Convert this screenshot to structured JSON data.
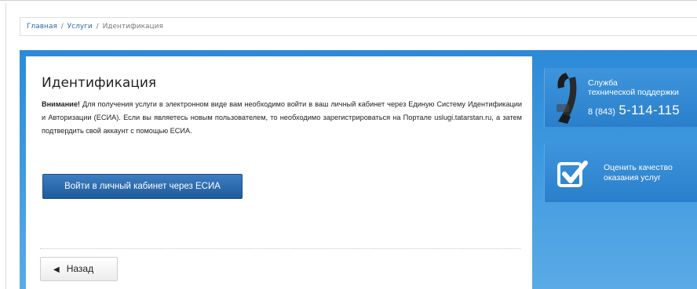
{
  "breadcrumb": {
    "home": "Главная",
    "services": "Услуги",
    "current": "Идентификация",
    "separator": "/"
  },
  "main": {
    "title": "Идентификация",
    "warning_label": "Внимание!",
    "warning_text": " Для получения услуги в электронном виде вам необходимо войти в ваш личный кабинет через Единую Систему Идентификации и Авторизации (ЕСИА). Если вы являетесь новым пользователем, то необходимо зарегистрироваться на Портале uslugi.tatarstan.ru, а затем подтвердить свой аккаунт с помощью ЕСИА.",
    "esia_button": "Войти в личный кабинет через ЕСИА",
    "back_button": "Назад"
  },
  "sidebar": {
    "support": {
      "title_line1": "Служба",
      "title_line2": "технической поддержки",
      "phone_prefix": "8 (843)",
      "phone_number": "5-114-115",
      "icon": "phone-icon"
    },
    "rate": {
      "title_line1": "Оценить качество",
      "title_line2": "оказания услуг",
      "icon": "checkbox-check-icon"
    }
  },
  "colors": {
    "panel_blue": "#2d8ad7",
    "link": "#2f6aa7",
    "esia_button": "#2a6aae"
  }
}
